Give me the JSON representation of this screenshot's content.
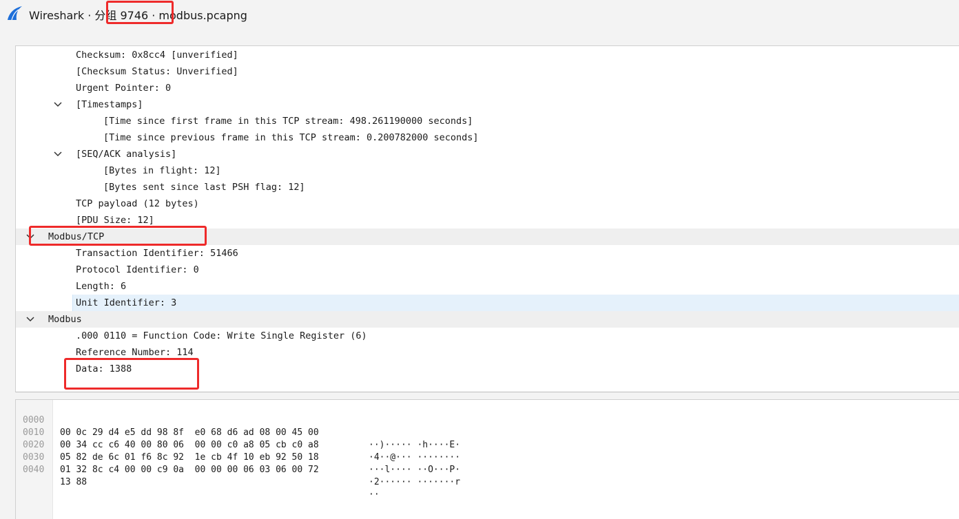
{
  "window": {
    "title": "Wireshark · 分组 9746 · modbus.pcapng"
  },
  "details": {
    "rows": [
      {
        "text": "Checksum: 0x8cc4 [unverified]"
      },
      {
        "text": "[Checksum Status: Unverified]"
      },
      {
        "text": "Urgent Pointer: 0"
      },
      {
        "text": "[Timestamps]",
        "expanded": true
      },
      {
        "text": "[Time since first frame in this TCP stream: 498.261190000 seconds]"
      },
      {
        "text": "[Time since previous frame in this TCP stream: 0.200782000 seconds]"
      },
      {
        "text": "[SEQ/ACK analysis]",
        "expanded": true
      },
      {
        "text": "[Bytes in flight: 12]"
      },
      {
        "text": "[Bytes sent since last PSH flag: 12]"
      },
      {
        "text": "TCP payload (12 bytes)"
      },
      {
        "text": "[PDU Size: 12]"
      },
      {
        "text": "Modbus/TCP",
        "expanded": true,
        "header": true
      },
      {
        "text": "Transaction Identifier: 51466"
      },
      {
        "text": "Protocol Identifier: 0"
      },
      {
        "text": "Length: 6"
      },
      {
        "text": "Unit Identifier: 3",
        "selected": true
      },
      {
        "text": "Modbus",
        "expanded": true,
        "header": true
      },
      {
        "text": ".000 0110 = Function Code: Write Single Register (6)"
      },
      {
        "text": "Reference Number: 114"
      },
      {
        "text": "Data: 1388"
      }
    ]
  },
  "hex": {
    "rows": [
      {
        "offset": "0000",
        "bytes": "00 0c 29 d4 e5 dd 98 8f  e0 68 d6 ad 08 00 45 00",
        "ascii": "··)····· ·h····E·"
      },
      {
        "offset": "0010",
        "bytes": "00 34 cc c6 40 00 80 06  00 00 c0 a8 05 cb c0 a8",
        "ascii": "·4··@··· ········"
      },
      {
        "offset": "0020",
        "bytes": "05 82 de 6c 01 f6 8c 92  1e cb 4f 10 eb 92 50 18",
        "ascii": "···l···· ··O···P·"
      },
      {
        "offset": "0030",
        "bytes": "01 32 8c c4 00 00 c9 0a  00 00 00 06 03 06 00 72",
        "ascii": "·2······ ·······r"
      },
      {
        "offset": "0040",
        "bytes": "13 88",
        "ascii": "··"
      }
    ]
  },
  "colors": {
    "annotation": "#ee2a2a",
    "selection": "#e5f1fb",
    "header_row": "#efefef",
    "icon_blue": "#1e6fd9"
  }
}
